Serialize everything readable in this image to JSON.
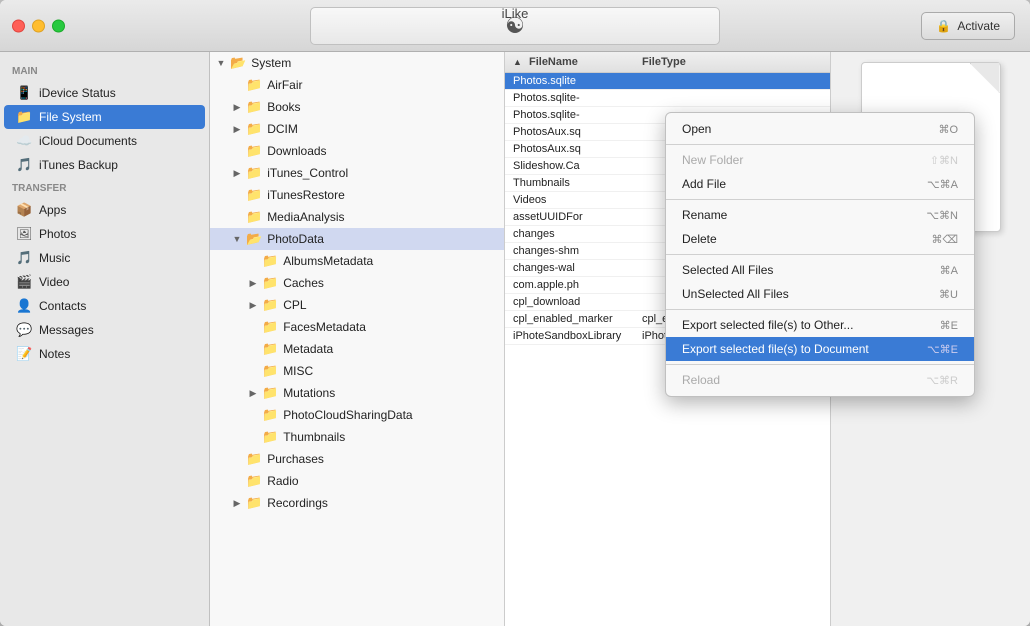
{
  "window": {
    "title": "iLike"
  },
  "titlebar": {
    "activate_label": "Activate",
    "logo_char": "🔄"
  },
  "sidebar": {
    "main_label": "Main",
    "transfer_label": "Transfer",
    "main_items": [
      {
        "id": "idevice-status",
        "label": "iDevice Status",
        "icon": "📱"
      },
      {
        "id": "file-system",
        "label": "File System",
        "icon": "📁",
        "active": true
      },
      {
        "id": "icloud-docs",
        "label": "iCloud Documents",
        "icon": "☁️"
      },
      {
        "id": "itunes-backup",
        "label": "iTunes Backup",
        "icon": "🎵"
      }
    ],
    "transfer_items": [
      {
        "id": "apps",
        "label": "Apps",
        "icon": "📦"
      },
      {
        "id": "photos",
        "label": "Photos",
        "icon": "🖼"
      },
      {
        "id": "music",
        "label": "Music",
        "icon": "🎵"
      },
      {
        "id": "video",
        "label": "Video",
        "icon": "🎬"
      },
      {
        "id": "contacts",
        "label": "Contacts",
        "icon": "👤"
      },
      {
        "id": "messages",
        "label": "Messages",
        "icon": "💬"
      },
      {
        "id": "notes",
        "label": "Notes",
        "icon": "📝"
      }
    ]
  },
  "tree": {
    "root": "System",
    "items": [
      {
        "id": "airfair",
        "label": "AirFair",
        "level": 1,
        "expanded": false,
        "hasChildren": false
      },
      {
        "id": "books",
        "label": "Books",
        "level": 1,
        "expanded": false,
        "hasChildren": true
      },
      {
        "id": "dcim",
        "label": "DCIM",
        "level": 1,
        "expanded": false,
        "hasChildren": true
      },
      {
        "id": "downloads",
        "label": "Downloads",
        "level": 1,
        "expanded": false,
        "hasChildren": false
      },
      {
        "id": "itunes-control",
        "label": "iTunes_Control",
        "level": 1,
        "expanded": false,
        "hasChildren": true
      },
      {
        "id": "itunesrestore",
        "label": "iTunesRestore",
        "level": 1,
        "expanded": false,
        "hasChildren": false
      },
      {
        "id": "mediaanalysis",
        "label": "MediaAnalysis",
        "level": 1,
        "expanded": false,
        "hasChildren": false
      },
      {
        "id": "photodata",
        "label": "PhotoData",
        "level": 1,
        "expanded": true,
        "hasChildren": true,
        "selected": true
      },
      {
        "id": "albumsmetadata",
        "label": "AlbumsMetadata",
        "level": 2,
        "expanded": false,
        "hasChildren": false
      },
      {
        "id": "caches",
        "label": "Caches",
        "level": 2,
        "expanded": false,
        "hasChildren": true
      },
      {
        "id": "cpl",
        "label": "CPL",
        "level": 2,
        "expanded": false,
        "hasChildren": true
      },
      {
        "id": "facesmetadata",
        "label": "FacesMetadata",
        "level": 2,
        "expanded": false,
        "hasChildren": false
      },
      {
        "id": "metadata",
        "label": "Metadata",
        "level": 2,
        "expanded": false,
        "hasChildren": false
      },
      {
        "id": "misc",
        "label": "MISC",
        "level": 2,
        "expanded": false,
        "hasChildren": false
      },
      {
        "id": "mutations",
        "label": "Mutations",
        "level": 2,
        "expanded": false,
        "hasChildren": true
      },
      {
        "id": "photocloudsharingdata",
        "label": "PhotoCloudSharingData",
        "level": 2,
        "expanded": false,
        "hasChildren": false
      },
      {
        "id": "thumbnails",
        "label": "Thumbnails",
        "level": 2,
        "expanded": false,
        "hasChildren": false
      },
      {
        "id": "purchases",
        "label": "Purchases",
        "level": 1,
        "expanded": false,
        "hasChildren": false
      },
      {
        "id": "radio",
        "label": "Radio",
        "level": 1,
        "expanded": false,
        "hasChildren": false
      },
      {
        "id": "recordings",
        "label": "Recordings",
        "level": 1,
        "expanded": false,
        "hasChildren": true
      }
    ]
  },
  "file_list": {
    "columns": {
      "filename": "FileName",
      "filetype": "FileType"
    },
    "files": [
      {
        "name": "Photos.sqlite",
        "type": "",
        "selected": true
      },
      {
        "name": "Photos.sqlite-",
        "type": ""
      },
      {
        "name": "Photos.sqlite-",
        "type": ""
      },
      {
        "name": "PhotosAux.sq",
        "type": ""
      },
      {
        "name": "PhotosAux.sq",
        "type": ""
      },
      {
        "name": "Slideshow.Ca",
        "type": ""
      },
      {
        "name": "Thumbnails",
        "type": ""
      },
      {
        "name": "Videos",
        "type": ""
      },
      {
        "name": "assetUUIDFor",
        "type": ""
      },
      {
        "name": "changes",
        "type": ""
      },
      {
        "name": "changes-shm",
        "type": ""
      },
      {
        "name": "changes-wal",
        "type": ""
      },
      {
        "name": "com.apple.ph",
        "type": ""
      },
      {
        "name": "cpl_download",
        "type": ""
      },
      {
        "name": "cpl_enabled_marker",
        "type": "cpl_enabled_marker"
      },
      {
        "name": "iPhoteSandboxLibrary",
        "type": "iPhoteSandboxLibrary"
      }
    ]
  },
  "context_menu": {
    "items": [
      {
        "id": "open",
        "label": "Open",
        "shortcut": "⌘O",
        "disabled": false,
        "highlighted": false,
        "separator_after": false
      },
      {
        "id": "sep1",
        "separator": true
      },
      {
        "id": "new-folder",
        "label": "New Folder",
        "shortcut": "⇧⌘N",
        "disabled": true,
        "highlighted": false,
        "separator_after": false
      },
      {
        "id": "add-file",
        "label": "Add File",
        "shortcut": "⌥⌘A",
        "disabled": false,
        "highlighted": false,
        "separator_after": false
      },
      {
        "id": "sep2",
        "separator": true
      },
      {
        "id": "rename",
        "label": "Rename",
        "shortcut": "⌥⌘N",
        "disabled": false,
        "highlighted": false,
        "separator_after": false
      },
      {
        "id": "delete",
        "label": "Delete",
        "shortcut": "⌘⌫",
        "disabled": false,
        "highlighted": false,
        "separator_after": false
      },
      {
        "id": "sep3",
        "separator": true
      },
      {
        "id": "select-all",
        "label": "Selected All Files",
        "shortcut": "⌘A",
        "disabled": false,
        "highlighted": false,
        "separator_after": false
      },
      {
        "id": "unselect-all",
        "label": "UnSelected All Files",
        "shortcut": "⌘U",
        "disabled": false,
        "highlighted": false,
        "separator_after": false
      },
      {
        "id": "sep4",
        "separator": true
      },
      {
        "id": "export-other",
        "label": "Export selected file(s) to Other...",
        "shortcut": "⌘E",
        "disabled": false,
        "highlighted": false,
        "separator_after": false
      },
      {
        "id": "export-doc",
        "label": "Export selected file(s) to Document",
        "shortcut": "⌥⌘E",
        "disabled": false,
        "highlighted": true,
        "separator_after": false
      },
      {
        "id": "sep5",
        "separator": true
      },
      {
        "id": "reload",
        "label": "Reload",
        "shortcut": "⌥⌘R",
        "disabled": true,
        "highlighted": false,
        "separator_after": false
      }
    ]
  }
}
